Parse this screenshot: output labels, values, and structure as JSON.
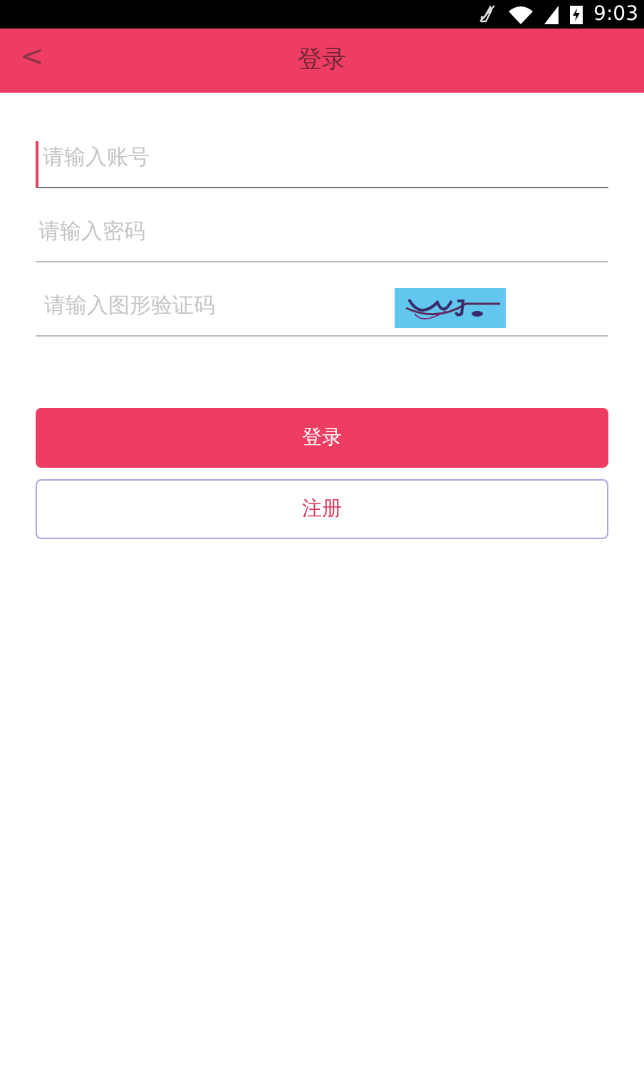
{
  "status_bar": {
    "time": "9:03"
  },
  "header": {
    "back": "<",
    "title": "登录"
  },
  "fields": [
    {
      "placeholder": "请输入账号",
      "focused": true
    },
    {
      "placeholder": "请输入密码",
      "focused": false
    },
    {
      "placeholder": "请输入图形验证码",
      "focused": false,
      "kind": "captcha"
    }
  ],
  "buttons": [
    {
      "label": "登录",
      "kind": "primary"
    },
    {
      "label": "注册",
      "kind": "outline"
    }
  ]
}
